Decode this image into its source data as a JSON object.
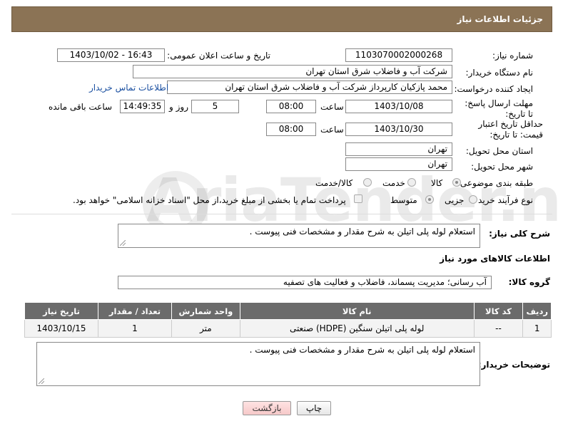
{
  "header": {
    "title": "جزئیات اطلاعات نیاز"
  },
  "form": {
    "need_number_label": "شماره نیاز:",
    "need_number": "1103070002000268",
    "announce_label": "تاریخ و ساعت اعلان عمومی:",
    "announce_value": "1403/10/02 - 16:43",
    "buyer_org_label": "نام دستگاه خریدار:",
    "buyer_org": "شرکت آب و فاضلاب شرق استان تهران",
    "requester_label": "ایجاد کننده درخواست:",
    "requester": "محمد پازکیان کارپرداز شرکت آب و فاضلاب شرق استان تهران",
    "buyer_contact_link": "اطلاعات تماس خریدار",
    "deadline_label": "مهلت ارسال پاسخ: تا تاریخ:",
    "deadline_date": "1403/10/08",
    "time_label": "ساعت",
    "deadline_time": "08:00",
    "days_value": "5",
    "days_label": "روز و",
    "remaining_time": "14:49:35",
    "remaining_label": "ساعت باقی مانده",
    "validity_label": "حداقل تاریخ اعتبار قیمت: تا تاریخ:",
    "validity_date": "1403/10/30",
    "validity_time": "08:00",
    "province_label": "استان محل تحویل:",
    "province": "تهران",
    "city_label": "شهر محل تحویل:",
    "city": "تهران",
    "category_label": "طبقه بندی موضوعی:",
    "category_options": [
      "کالا",
      "خدمت",
      "کالا/خدمت"
    ],
    "process_label": "نوع فرآیند خرید :",
    "process_options": [
      "جزیی",
      "متوسط"
    ],
    "payment_note": "پرداخت تمام یا بخشی از مبلغ خرید،از محل \"اسناد خزانه اسلامی\" خواهد بود.",
    "summary_label": "شرح کلی نیاز:",
    "summary": "استعلام لوله پلی اتیلن به شرح مقدار و مشخصات فنی پیوست ."
  },
  "goods": {
    "section_title": "اطلاعات کالاهای مورد نیاز",
    "group_label": "گروه کالا:",
    "group_value": "آب رسانی؛ مدیریت پسماند، فاضلاب و فعالیت های تصفیه",
    "columns": [
      "ردیف",
      "کد کالا",
      "نام کالا",
      "واحد شمارش",
      "تعداد / مقدار",
      "تاریخ نیاز"
    ],
    "rows": [
      [
        "1",
        "--",
        "لوله پلی اتیلن سنگین (HDPE) صنعتی",
        "متر",
        "1",
        "1403/10/15"
      ]
    ]
  },
  "buyer_notes": {
    "label": "توضیحات خریدار:",
    "text": "استعلام لوله پلی اتیلن به شرح مقدار و مشخصات فنی پیوست ."
  },
  "buttons": {
    "print": "چاپ",
    "back": "بازگشت"
  },
  "watermark": "AriaTender.neT"
}
